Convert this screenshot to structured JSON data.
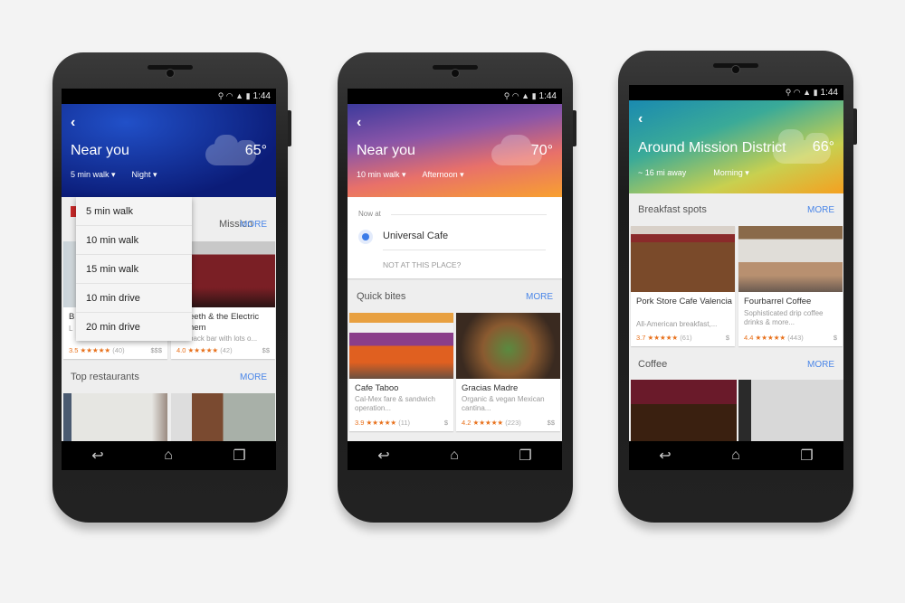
{
  "status_bar": {
    "time": "1:44",
    "icons": [
      "location-icon",
      "wifi-icon",
      "signal-icon",
      "battery-icon"
    ]
  },
  "nav_bar": {
    "icons": [
      "back-icon",
      "home-icon",
      "recents-icon"
    ]
  },
  "phones": [
    {
      "header": {
        "back": "‹",
        "title": "Near you",
        "temp": "65°",
        "filter1": "5 min walk ▾",
        "filter2": "Night ▾",
        "gradient": [
          "#1a3fb0",
          "#0a1a6e"
        ]
      },
      "section1": {
        "title_fragment": "Mission",
        "more": "MORE"
      },
      "cards": [
        {
          "name": "B",
          "desc": "L",
          "rating": "3.5",
          "stars": "★★★★★",
          "count": "(40)",
          "price": "$$$"
        },
        {
          "name": "eeth & the Electric",
          "name2": "hem",
          "desc": "back bar with lots o...",
          "rating": "4.0",
          "stars": "★★★★★",
          "count": "(42)",
          "price": "$$"
        }
      ],
      "section2": {
        "title": "Top restaurants",
        "more": "MORE"
      },
      "dropdown": [
        "5 min walk",
        "10 min walk",
        "15 min walk",
        "10 min drive",
        "20 min drive"
      ]
    },
    {
      "header": {
        "back": "‹",
        "title": "Near you",
        "temp": "70°",
        "filter1": "10 min walk ▾",
        "filter2": "Afternoon ▾",
        "gradient": [
          "#4a3fa0",
          "#f59a2e"
        ]
      },
      "now_at": {
        "label": "Now at",
        "place": "Universal Cafe",
        "link": "NOT AT THIS PLACE?"
      },
      "section1": {
        "title": "Quick bites",
        "more": "MORE"
      },
      "cards": [
        {
          "name": "Cafe Taboo",
          "desc": "Cal-Mex fare & sandwich operation...",
          "rating": "3.9",
          "stars": "★★★★★",
          "count": "(11)",
          "price": "$"
        },
        {
          "name": "Gracias Madre",
          "desc": "Organic & vegan Mexican cantina...",
          "rating": "4.2",
          "stars": "★★★★★",
          "count": "(223)",
          "price": "$$"
        }
      ]
    },
    {
      "header": {
        "back": "‹",
        "title": "Around Mission District",
        "temp": "66°",
        "filter1": "~ 16 mi away",
        "filter2": "Morning ▾",
        "gradient": [
          "#1e8fa8",
          "#f5a623"
        ]
      },
      "section1": {
        "title": "Breakfast spots",
        "more": "MORE"
      },
      "cards": [
        {
          "name": "Pork Store Cafe Valencia",
          "desc": "All-American breakfast,...",
          "rating": "3.7",
          "stars": "★★★★★",
          "count": "(61)",
          "price": "$"
        },
        {
          "name": "Fourbarrel Coffee",
          "desc": "Sophisticated drip coffee drinks & more...",
          "rating": "4.4",
          "stars": "★★★★★",
          "count": "(443)",
          "price": "$"
        }
      ],
      "section2": {
        "title": "Coffee",
        "more": "MORE"
      }
    }
  ]
}
